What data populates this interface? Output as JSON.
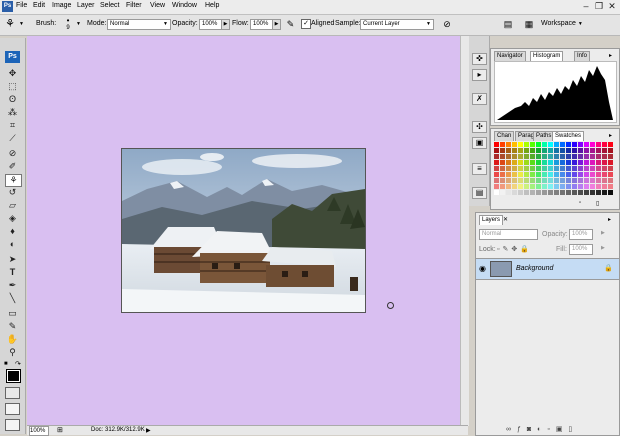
{
  "menu": {
    "items": [
      "File",
      "Edit",
      "Image",
      "Layer",
      "Select",
      "Filter",
      "View",
      "Window",
      "Help"
    ]
  },
  "options": {
    "brush_label": "Brush:",
    "brush_size": "9",
    "mode_label": "Mode:",
    "mode_value": "Normal",
    "opacity_label": "Opacity:",
    "opacity_value": "100%",
    "flow_label": "Flow:",
    "flow_value": "100%",
    "aligned_label": "Aligned",
    "sample_label": "Sample:",
    "sample_value": "Current Layer",
    "workspace_label": "Workspace"
  },
  "toolbox": {
    "logo": "Ps"
  },
  "status": {
    "zoom": "100%",
    "doc": "Doc: 312.9K/312.9K"
  },
  "navigator": {
    "tabs": [
      "Navigator",
      "Histogram",
      "Info"
    ]
  },
  "swatches": {
    "tabs": [
      "Chan",
      "Parag",
      "Paths",
      "Swatches"
    ]
  },
  "layers": {
    "tab": "Layers",
    "blend": "Normal",
    "opacity_label": "Opacity:",
    "opacity_value": "100%",
    "lock_label": "Lock:",
    "fill_label": "Fill:",
    "fill_value": "100%",
    "layer_name": "Background"
  },
  "colors": {
    "canvas": "#d9bff1",
    "selected_layer": "#c5dcf4"
  }
}
